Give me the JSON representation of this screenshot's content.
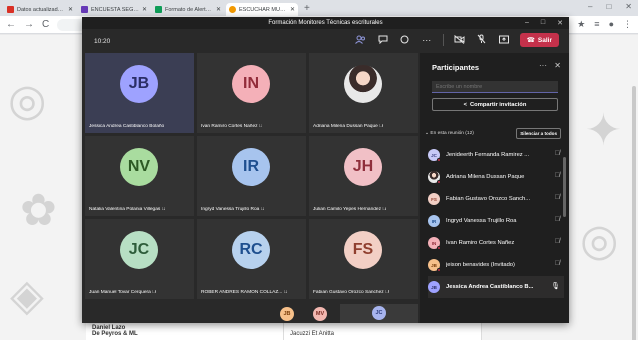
{
  "browser": {
    "tabs": [
      {
        "title": "Datos actualizados - ...",
        "favicon_color": "#d93025",
        "active": false
      },
      {
        "title": "ENCUESTA SEGUIMIENTO PLAN...",
        "favicon_color": "#673ab7",
        "active": false
      },
      {
        "title": "Formato de Alertas - Google D...",
        "favicon_color": "#0f9d58",
        "active": false
      },
      {
        "title": "ESCUCHAR MUSICA DE FRESC...",
        "favicon_color": "#f29900",
        "active": true
      }
    ],
    "new_tab": "+",
    "controls": {
      "minimize": "–",
      "maximize": "□",
      "close": "✕"
    },
    "nav": {
      "back": "←",
      "forward": "→",
      "reload": "C"
    }
  },
  "meeting": {
    "window_title": "Formación Monitores Técnicas escriturales",
    "window_controls": {
      "minimize": "–",
      "maximize": "□",
      "close": "✕"
    },
    "timer": "10:20",
    "leave_label": "Salir"
  },
  "tiles": [
    {
      "initials": "JB",
      "name": "Jessica Andrea Castiblanco Bolaño",
      "bg": "#9ea2ff",
      "fg": "#2b2e66",
      "photo": false,
      "mic_off": false,
      "active": true
    },
    {
      "initials": "IN",
      "name": "Ivan Ramiro Cortes Nañez",
      "bg": "#f4b0b8",
      "fg": "#922c3a",
      "photo": false,
      "mic_off": true,
      "active": false
    },
    {
      "initials": "",
      "name": "Adriana Milena Dussan Paque",
      "bg": "#e8e8e8",
      "fg": "#333333",
      "photo": true,
      "mic_off": true,
      "active": false
    },
    {
      "initials": "NV",
      "name": "Natalia Valentina Polania Villegas",
      "bg": "#a9dc9f",
      "fg": "#2d5a24",
      "photo": false,
      "mic_off": true,
      "active": false
    },
    {
      "initials": "IR",
      "name": "Ingryd Vanessa Trujillo Roa",
      "bg": "#a7c4ee",
      "fg": "#1f4f8f",
      "photo": false,
      "mic_off": true,
      "active": false
    },
    {
      "initials": "JH",
      "name": "Julian Camilo Yepes Hernandez",
      "bg": "#f1c0c6",
      "fg": "#8f2f3c",
      "photo": false,
      "mic_off": true,
      "active": false
    },
    {
      "initials": "JC",
      "name": "Juan Manuel Tovar Cerquera",
      "bg": "#b7dfc4",
      "fg": "#2d5c3a",
      "photo": false,
      "mic_off": true,
      "active": false
    },
    {
      "initials": "RC",
      "name": "ROBER ANDRÉS RAMÓN COLLAZ...",
      "bg": "#b7d1ee",
      "fg": "#1f4f8f",
      "photo": false,
      "mic_off": true,
      "active": false
    },
    {
      "initials": "FS",
      "name": "Fabian Gustavo Orozco Sanchez",
      "bg": "#f2cfc5",
      "fg": "#8f3f2f",
      "photo": false,
      "mic_off": true,
      "active": false
    }
  ],
  "overflow": [
    {
      "initials": "JB",
      "bg": "#f7c08a",
      "fg": "#7a3d0a"
    },
    {
      "initials": "MV",
      "bg": "#f2b7b0",
      "fg": "#7a2a22"
    },
    {
      "initials": "JC",
      "bg": "#a7b4ee",
      "fg": "#2b3a7a"
    }
  ],
  "participants": {
    "title": "Participantes",
    "more": "···",
    "close": "✕",
    "search_placeholder": "Escribe un nombre",
    "share_label": "Compartir invitación",
    "section_label": "En esta reunión (12)",
    "mute_all": "Silenciar a todos",
    "list": [
      {
        "initials": "JC",
        "name": "Jenideerth Fernanda Ramirez ...",
        "bg": "#c7c9f7",
        "fg": "#3b3e80",
        "me": false
      },
      {
        "initials": "",
        "name": "Adriana Milena Dussan Paque",
        "bg": "#e8e8e8",
        "fg": "#333333",
        "me": false
      },
      {
        "initials": "FS",
        "name": "Fabian Gustavo Orozco Sanch...",
        "bg": "#f2cfc5",
        "fg": "#8f3f2f",
        "me": false
      },
      {
        "initials": "IR",
        "name": "Ingryd Vanessa Trujillo Roa",
        "bg": "#a7c4ee",
        "fg": "#1f4f8f",
        "me": false
      },
      {
        "initials": "IN",
        "name": "Ivan Ramiro Cortes Nañez",
        "bg": "#f4b0b8",
        "fg": "#922c3a",
        "me": false
      },
      {
        "initials": "JB",
        "name": "jeison benavides (Invitado)",
        "bg": "#f7c08a",
        "fg": "#7a3d0a",
        "me": false
      },
      {
        "initials": "JB",
        "name": "Jessica Andrea Castiblanco B...",
        "bg": "#9ea2ff",
        "fg": "#2b2e66",
        "me": true
      }
    ]
  },
  "background_page": {
    "items": [
      "Daniel Lazo",
      "De Peyros & ML",
      "Jacuzzi Et Anitta"
    ]
  }
}
